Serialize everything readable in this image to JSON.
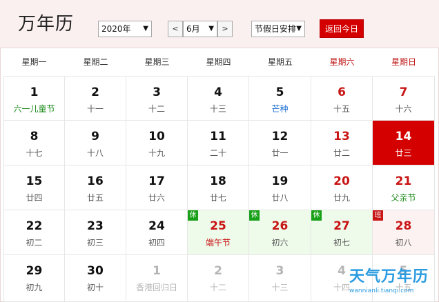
{
  "app": {
    "title": "万年历"
  },
  "controls": {
    "year_value": "2020年",
    "month_value": "6月",
    "prev_label": "<",
    "next_label": ">",
    "holiday_value": "节假日安排",
    "today_button": "返回今日"
  },
  "weekdays": [
    {
      "label": "星期一",
      "weekend": false
    },
    {
      "label": "星期二",
      "weekend": false
    },
    {
      "label": "星期三",
      "weekend": false
    },
    {
      "label": "星期四",
      "weekend": false
    },
    {
      "label": "星期五",
      "weekend": false
    },
    {
      "label": "星期六",
      "weekend": true
    },
    {
      "label": "星期日",
      "weekend": true
    }
  ],
  "days": [
    {
      "day": "1",
      "sub": "六一儿童节",
      "numClass": "",
      "subClass": "green"
    },
    {
      "day": "2",
      "sub": "十一",
      "numClass": "",
      "subClass": ""
    },
    {
      "day": "3",
      "sub": "十二",
      "numClass": "",
      "subClass": ""
    },
    {
      "day": "4",
      "sub": "十三",
      "numClass": "",
      "subClass": ""
    },
    {
      "day": "5",
      "sub": "芒种",
      "numClass": "",
      "subClass": "blue"
    },
    {
      "day": "6",
      "sub": "十五",
      "numClass": "red",
      "subClass": ""
    },
    {
      "day": "7",
      "sub": "十六",
      "numClass": "red",
      "subClass": ""
    },
    {
      "day": "8",
      "sub": "十七",
      "numClass": "",
      "subClass": ""
    },
    {
      "day": "9",
      "sub": "十八",
      "numClass": "",
      "subClass": ""
    },
    {
      "day": "10",
      "sub": "十九",
      "numClass": "",
      "subClass": ""
    },
    {
      "day": "11",
      "sub": "二十",
      "numClass": "",
      "subClass": ""
    },
    {
      "day": "12",
      "sub": "廿一",
      "numClass": "",
      "subClass": ""
    },
    {
      "day": "13",
      "sub": "廿二",
      "numClass": "red",
      "subClass": ""
    },
    {
      "day": "14",
      "sub": "廿三",
      "numClass": "",
      "subClass": "",
      "selected": true
    },
    {
      "day": "15",
      "sub": "廿四",
      "numClass": "",
      "subClass": ""
    },
    {
      "day": "16",
      "sub": "廿五",
      "numClass": "",
      "subClass": ""
    },
    {
      "day": "17",
      "sub": "廿六",
      "numClass": "",
      "subClass": ""
    },
    {
      "day": "18",
      "sub": "廿七",
      "numClass": "",
      "subClass": ""
    },
    {
      "day": "19",
      "sub": "廿八",
      "numClass": "",
      "subClass": ""
    },
    {
      "day": "20",
      "sub": "廿九",
      "numClass": "red",
      "subClass": ""
    },
    {
      "day": "21",
      "sub": "父亲节",
      "numClass": "red",
      "subClass": "green"
    },
    {
      "day": "22",
      "sub": "初二",
      "numClass": "",
      "subClass": ""
    },
    {
      "day": "23",
      "sub": "初三",
      "numClass": "",
      "subClass": ""
    },
    {
      "day": "24",
      "sub": "初四",
      "numClass": "",
      "subClass": ""
    },
    {
      "day": "25",
      "sub": "端午节",
      "numClass": "red",
      "subClass": "redtxt",
      "badge": "休",
      "badgeType": "xiu",
      "bg": "holiday"
    },
    {
      "day": "26",
      "sub": "初六",
      "numClass": "red",
      "subClass": "",
      "badge": "休",
      "badgeType": "xiu",
      "bg": "holiday"
    },
    {
      "day": "27",
      "sub": "初七",
      "numClass": "red",
      "subClass": "",
      "badge": "休",
      "badgeType": "xiu",
      "bg": "holiday"
    },
    {
      "day": "28",
      "sub": "初八",
      "numClass": "red",
      "subClass": "",
      "badge": "班",
      "badgeType": "ban",
      "bg": "workday"
    },
    {
      "day": "29",
      "sub": "初九",
      "numClass": "",
      "subClass": ""
    },
    {
      "day": "30",
      "sub": "初十",
      "numClass": "",
      "subClass": ""
    },
    {
      "day": "1",
      "sub": "香港回归日",
      "numClass": "",
      "subClass": "",
      "other": true
    },
    {
      "day": "2",
      "sub": "十二",
      "numClass": "",
      "subClass": "",
      "other": true
    },
    {
      "day": "3",
      "sub": "十三",
      "numClass": "",
      "subClass": "",
      "other": true
    },
    {
      "day": "4",
      "sub": "十四",
      "numClass": "",
      "subClass": "",
      "other": true
    },
    {
      "day": "5",
      "sub": "十五",
      "numClass": "",
      "subClass": "",
      "other": true
    }
  ],
  "watermark": {
    "title": "天气万年历",
    "url": "wannianli.tianqi.com"
  },
  "colors": {
    "accent": "#d40000",
    "holiday_bg": "#eefaea",
    "workday_bg": "#fdf2f2",
    "rest_badge": "#18a018"
  }
}
